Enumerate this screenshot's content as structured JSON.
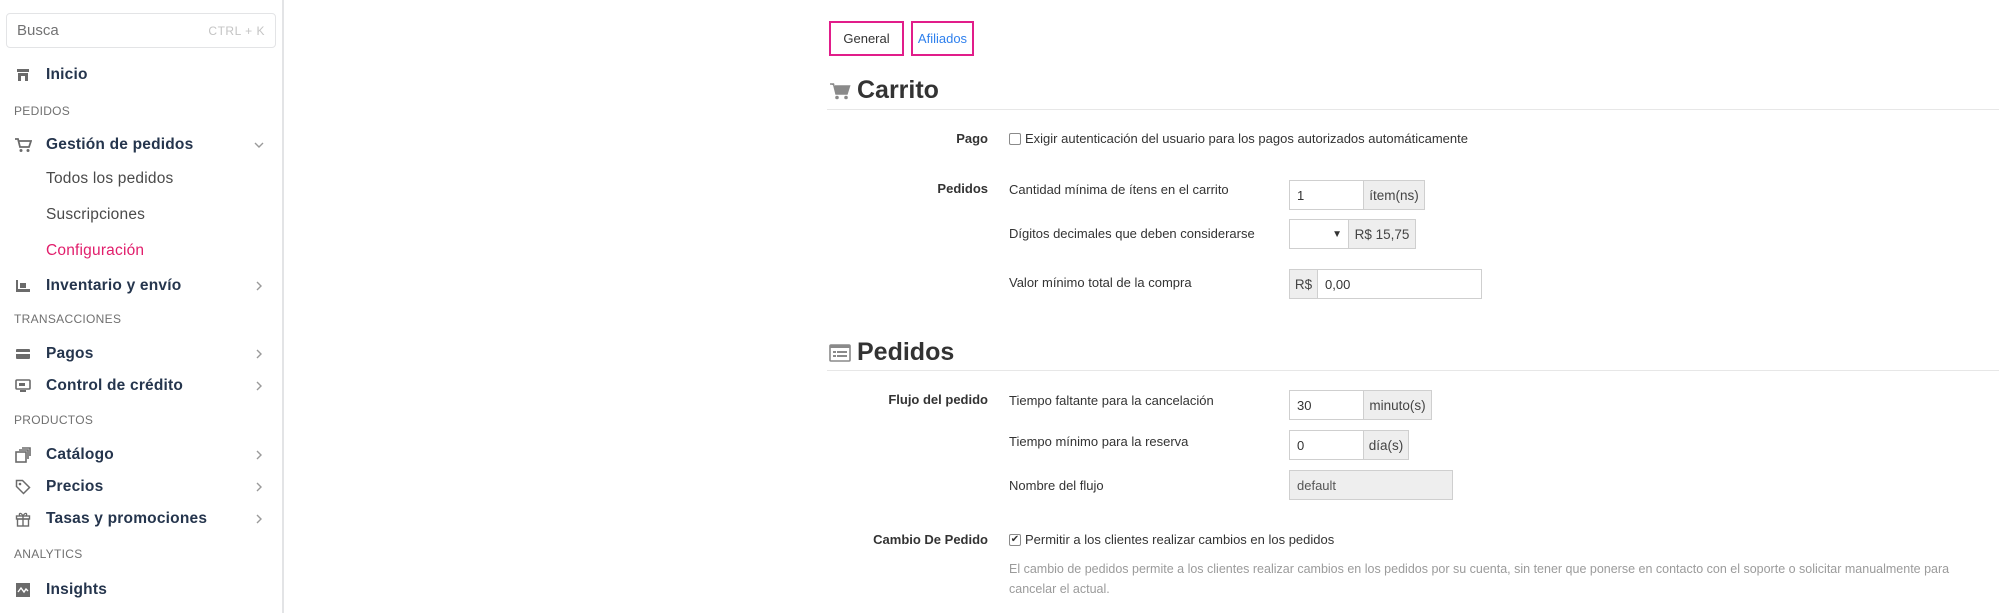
{
  "sidebar": {
    "search": {
      "placeholder": "Busca",
      "shortcut": "CTRL + K"
    },
    "items": [
      {
        "label": "Inicio",
        "icon": "store-icon"
      },
      {
        "section": "PEDIDOS"
      },
      {
        "label": "Gestión de pedidos",
        "icon": "cart-icon",
        "expanded": true
      },
      {
        "label": "Todos los pedidos"
      },
      {
        "label": "Suscripciones"
      },
      {
        "label": "Configuración",
        "active": true
      },
      {
        "label": "Inventario y envío",
        "icon": "shipping-icon"
      },
      {
        "section": "TRANSACCIONES"
      },
      {
        "label": "Pagos",
        "icon": "card-icon"
      },
      {
        "label": "Control de crédito",
        "icon": "credit-icon"
      },
      {
        "section": "PRODUCTOS"
      },
      {
        "label": "Catálogo",
        "icon": "catalog-icon"
      },
      {
        "label": "Precios",
        "icon": "tag-icon"
      },
      {
        "label": "Tasas y promociones",
        "icon": "gift-icon"
      },
      {
        "section": "ANALYTICS"
      },
      {
        "label": "Insights",
        "icon": "insights-icon"
      }
    ]
  },
  "tabs": {
    "general": "General",
    "afiliados": "Afiliados"
  },
  "carrito": {
    "title": "Carrito",
    "pago_label": "Pago",
    "pago_checkbox": "Exigir autenticación del usuario para los pagos autorizados automáticamente",
    "pedidos_label": "Pedidos",
    "min_items_label": "Cantidad mínima de ítens en el carrito",
    "min_items_value": "1",
    "min_items_unit": "ítem(ns)",
    "decimal_label": "Dígitos decimales que deben considerarse",
    "decimal_select": "",
    "decimal_preview": "R$ 15,75",
    "min_total_label": "Valor mínimo total de la compra",
    "min_total_currency": "R$",
    "min_total_value": "0,00"
  },
  "pedidos": {
    "title": "Pedidos",
    "flujo_label": "Flujo del pedido",
    "cancel_label": "Tiempo faltante para la cancelación",
    "cancel_value": "30",
    "cancel_unit": "minuto(s)",
    "reserva_label": "Tiempo mínimo para la reserva",
    "reserva_value": "0",
    "reserva_unit": "día(s)",
    "flujo_name_label": "Nombre del flujo",
    "flujo_name_value": "default",
    "cambio_label": "Cambio De Pedido",
    "cambio_checkbox": "Permitir a los clientes realizar cambios en los pedidos",
    "cambio_help_1": "El cambio de pedidos permite a los clientes realizar cambios en los pedidos por su cuenta, sin tener que ponerse en contacto con el soporte o solicitar manualmente para",
    "cambio_help_2": "cancelar el actual."
  },
  "colors": {
    "accent": "#e11d6b",
    "tab_border": "#e11d8a",
    "link": "#2f80ed"
  }
}
